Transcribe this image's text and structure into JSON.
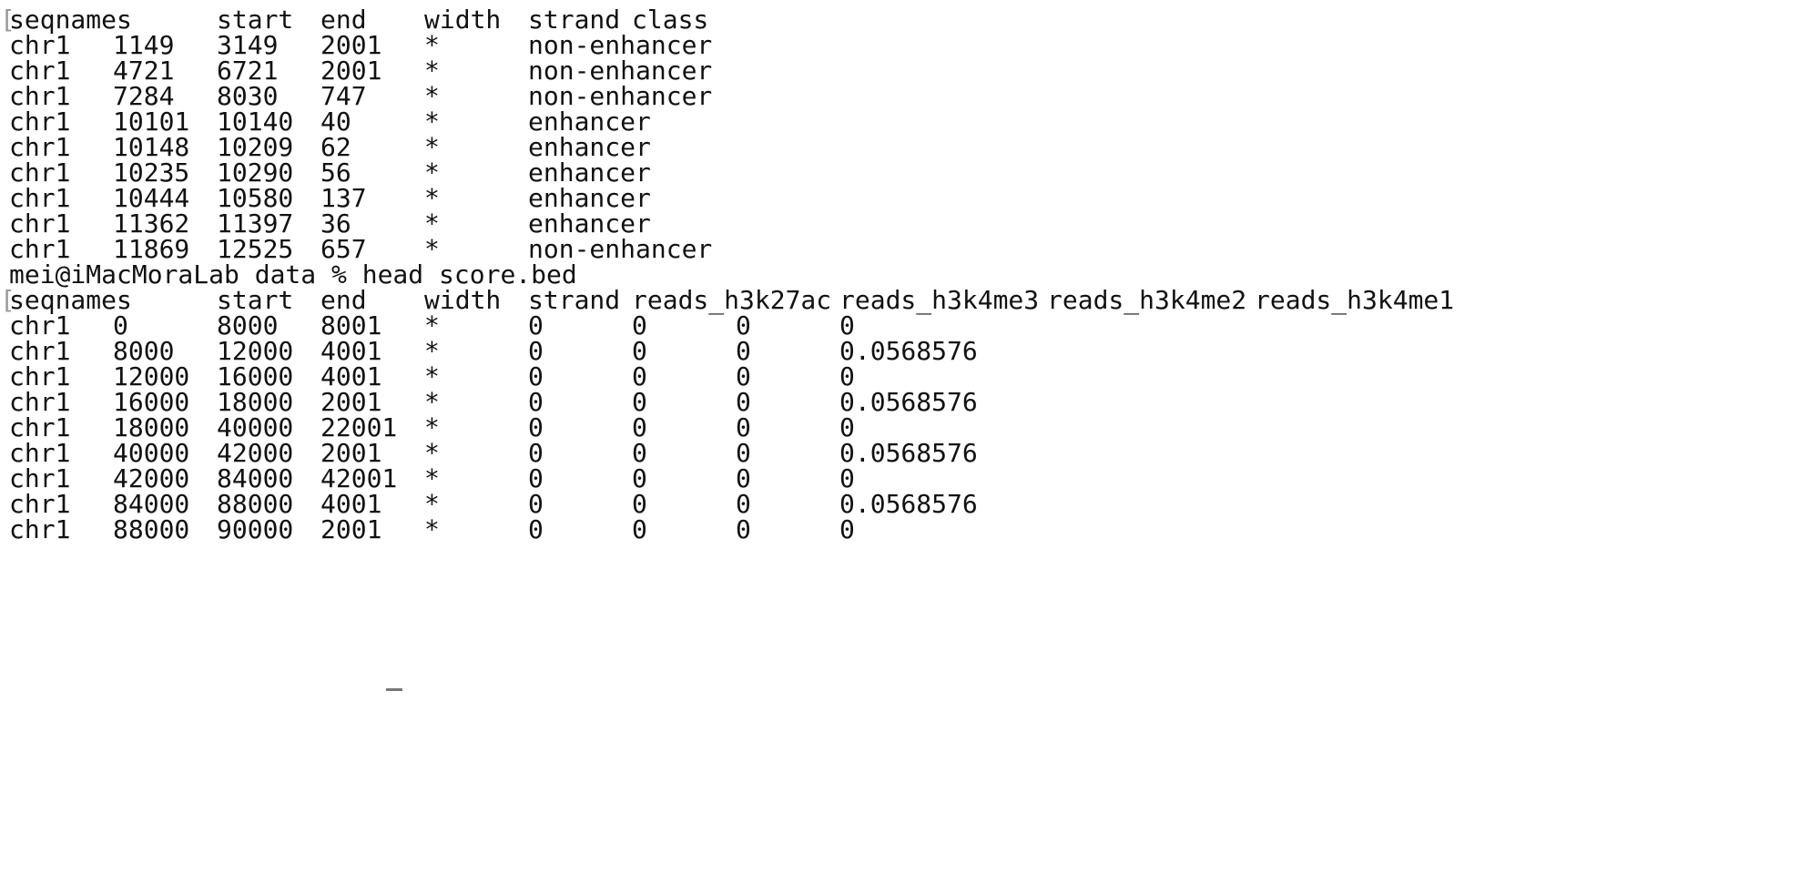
{
  "table1": {
    "headers": [
      "seqnames",
      "start",
      "end",
      "width",
      "strand",
      "class"
    ],
    "rows": [
      [
        "chr1",
        "1149",
        "3149",
        "2001",
        "*",
        "non-enhancer"
      ],
      [
        "chr1",
        "4721",
        "6721",
        "2001",
        "*",
        "non-enhancer"
      ],
      [
        "chr1",
        "7284",
        "8030",
        "747",
        "*",
        "non-enhancer"
      ],
      [
        "chr1",
        "10101",
        "10140",
        "40",
        "*",
        "enhancer"
      ],
      [
        "chr1",
        "10148",
        "10209",
        "62",
        "*",
        "enhancer"
      ],
      [
        "chr1",
        "10235",
        "10290",
        "56",
        "*",
        "enhancer"
      ],
      [
        "chr1",
        "10444",
        "10580",
        "137",
        "*",
        "enhancer"
      ],
      [
        "chr1",
        "11362",
        "11397",
        "36",
        "*",
        "enhancer"
      ],
      [
        "chr1",
        "11869",
        "12525",
        "657",
        "*",
        "non-enhancer"
      ]
    ]
  },
  "command": "mei@iMacMoraLab data % head score.bed",
  "table2": {
    "headers": [
      "seqnames",
      "start",
      "end",
      "width",
      "strand",
      "reads_h3k27ac",
      "reads_h3k4me3",
      "reads_h3k4me2",
      "reads_h3k4me1"
    ],
    "rows": [
      [
        "chr1",
        "0",
        "8000",
        "8001",
        "*",
        "0",
        "0",
        "0",
        "0"
      ],
      [
        "chr1",
        "8000",
        "12000",
        "4001",
        "*",
        "0",
        "0",
        "0",
        "0.0568576"
      ],
      [
        "chr1",
        "12000",
        "16000",
        "4001",
        "*",
        "0",
        "0",
        "0",
        "0"
      ],
      [
        "chr1",
        "16000",
        "18000",
        "2001",
        "*",
        "0",
        "0",
        "0",
        "0.0568576"
      ],
      [
        "chr1",
        "18000",
        "40000",
        "22001",
        "*",
        "0",
        "0",
        "0",
        "0"
      ],
      [
        "chr1",
        "40000",
        "42000",
        "2001",
        "*",
        "0",
        "0",
        "0",
        "0.0568576"
      ],
      [
        "chr1",
        "42000",
        "84000",
        "42001",
        "*",
        "0",
        "0",
        "0",
        "0"
      ],
      [
        "chr1",
        "84000",
        "88000",
        "4001",
        "*",
        "0",
        "0",
        "0",
        "0.0568576"
      ],
      [
        "chr1",
        "88000",
        "90000",
        "2001",
        "*",
        "0",
        "0",
        "0",
        "0"
      ]
    ]
  }
}
